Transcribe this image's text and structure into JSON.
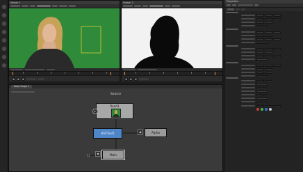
{
  "viewer_left": {
    "title": "Viewer 1"
  },
  "viewer_right": {
    "title": "Viewer 2"
  },
  "node_graph": {
    "tab_label": "Node Graph 1",
    "section_label": "Source",
    "nodes": {
      "read": "Read1",
      "keyer": "HSVTool1",
      "alpha": "Alpha",
      "main": "Main"
    }
  },
  "properties": {
    "panel_title": "Properties"
  },
  "colors": {
    "green_screen": "#2f8a3a",
    "alpha_white": "#f2f2f2",
    "keyer_node": "#4f86c9",
    "viewer_node": "#8a8a8a",
    "playhead": "#e89a2c"
  },
  "icons": [
    "record-icon",
    "eye-icon",
    "play-icon",
    "rewind-icon",
    "forward-icon",
    "settings-icon"
  ]
}
